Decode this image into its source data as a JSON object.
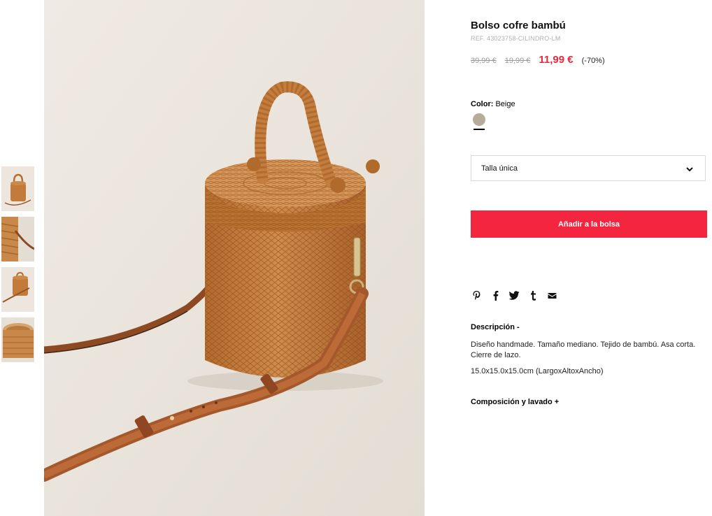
{
  "thumbnails": [
    {
      "icon": "bag-thumbnail-full"
    },
    {
      "icon": "bag-thumbnail-strap-detail"
    },
    {
      "icon": "bag-thumbnail-side"
    },
    {
      "icon": "bag-thumbnail-open"
    }
  ],
  "product": {
    "title": "Bolso cofre bambú",
    "ref": "REF. 43023758-CILINDRO-LM",
    "price_original": "39,99 €",
    "price_previous": "19,99 €",
    "price_sale": "11,99 €",
    "discount": "(-70%)"
  },
  "color": {
    "label": "Color:",
    "value": "Beige",
    "swatch_hex": "#b7ab9a"
  },
  "size": {
    "selected": "Talla única"
  },
  "add_to_bag": {
    "label": "Añadir a la bolsa",
    "color": "#f4253f"
  },
  "share": [
    "pinterest-icon",
    "facebook-icon",
    "twitter-icon",
    "tumblr-icon",
    "email-icon"
  ],
  "description": {
    "heading": "Descripción -",
    "text": "Diseño handmade. Tamaño mediano. Tejido de bambú. Asa corta. Cierre de lazo.",
    "dimensions": "15.0x15.0x15.0cm (LargoxAltoxAncho)"
  },
  "composition": {
    "heading": "Composición y lavado +"
  },
  "colors": {
    "sale_red": "#e8273a",
    "rattan": "#c07a3a",
    "background": "#ebe5dd"
  }
}
